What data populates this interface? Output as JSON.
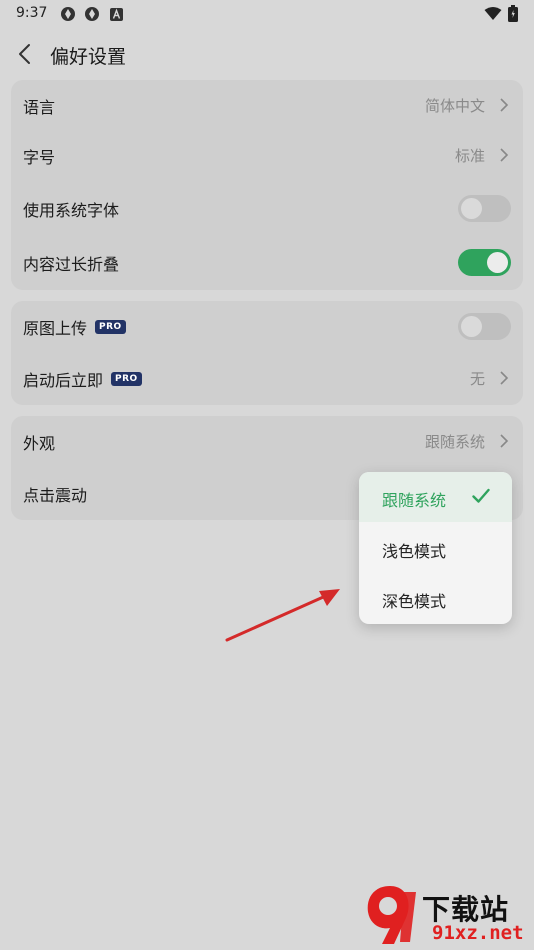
{
  "status_bar": {
    "time": "9:37"
  },
  "header": {
    "title": "偏好设置"
  },
  "card1": {
    "language": {
      "label": "语言",
      "value": "简体中文"
    },
    "font_size": {
      "label": "字号",
      "value": "标准"
    },
    "system_font": {
      "label": "使用系统字体",
      "enabled": false
    },
    "fold_long": {
      "label": "内容过长折叠",
      "enabled": true
    }
  },
  "card2": {
    "original_upload": {
      "label": "原图上传",
      "badge": "PRO",
      "enabled": false
    },
    "launch_immediate": {
      "label": "启动后立即",
      "badge": "PRO",
      "value": "无"
    }
  },
  "card3": {
    "appearance": {
      "label": "外观",
      "value": "跟随系统"
    },
    "haptic": {
      "label": "点击震动"
    }
  },
  "appearance_menu": {
    "options": [
      "跟随系统",
      "浅色模式",
      "深色模式"
    ],
    "selected": "跟随系统"
  },
  "watermark": {
    "title": "下载站",
    "url": "91xz.net"
  },
  "colors": {
    "accent": "#2fa35d",
    "badge": "#223366",
    "arrow": "#d42a2a"
  }
}
